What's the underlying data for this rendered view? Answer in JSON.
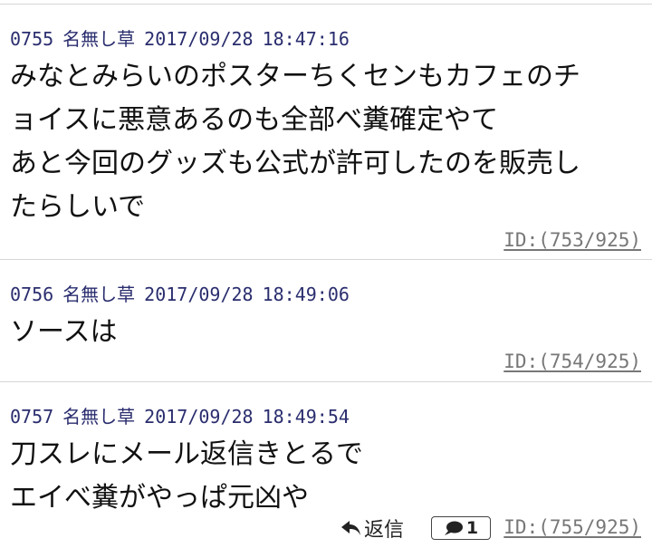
{
  "posts": [
    {
      "number": "0755",
      "name": "名無し草",
      "date": "2017/09/28",
      "time": "18:47:16",
      "lines": [
        "みなとみらいのポスターちくセンもカフェのチ",
        "ョイスに悪意あるのも全部べ糞確定やて",
        "あと今回のグッズも公式が許可したのを販売し",
        "たらしいで"
      ],
      "id_text": "ID:(753/925)"
    },
    {
      "number": "0756",
      "name": "名無し草",
      "date": "2017/09/28",
      "time": "18:49:06",
      "lines": [
        "ソースは"
      ],
      "id_text": "ID:(754/925)"
    },
    {
      "number": "0757",
      "name": "名無し草",
      "date": "2017/09/28",
      "time": "18:49:54",
      "lines": [
        "刀スレにメール返信きとるで",
        "エイべ糞がやっぱ元凶や"
      ],
      "reply_label": "返信",
      "reply_count": "1",
      "id_text": "ID:(755/925)"
    }
  ],
  "icons": {
    "reply": "reply-arrow-icon",
    "comment": "speech-bubble-icon"
  },
  "colors": {
    "header_text": "#2a2d6e",
    "id_text": "#777777",
    "divider": "#d6d6d6"
  }
}
